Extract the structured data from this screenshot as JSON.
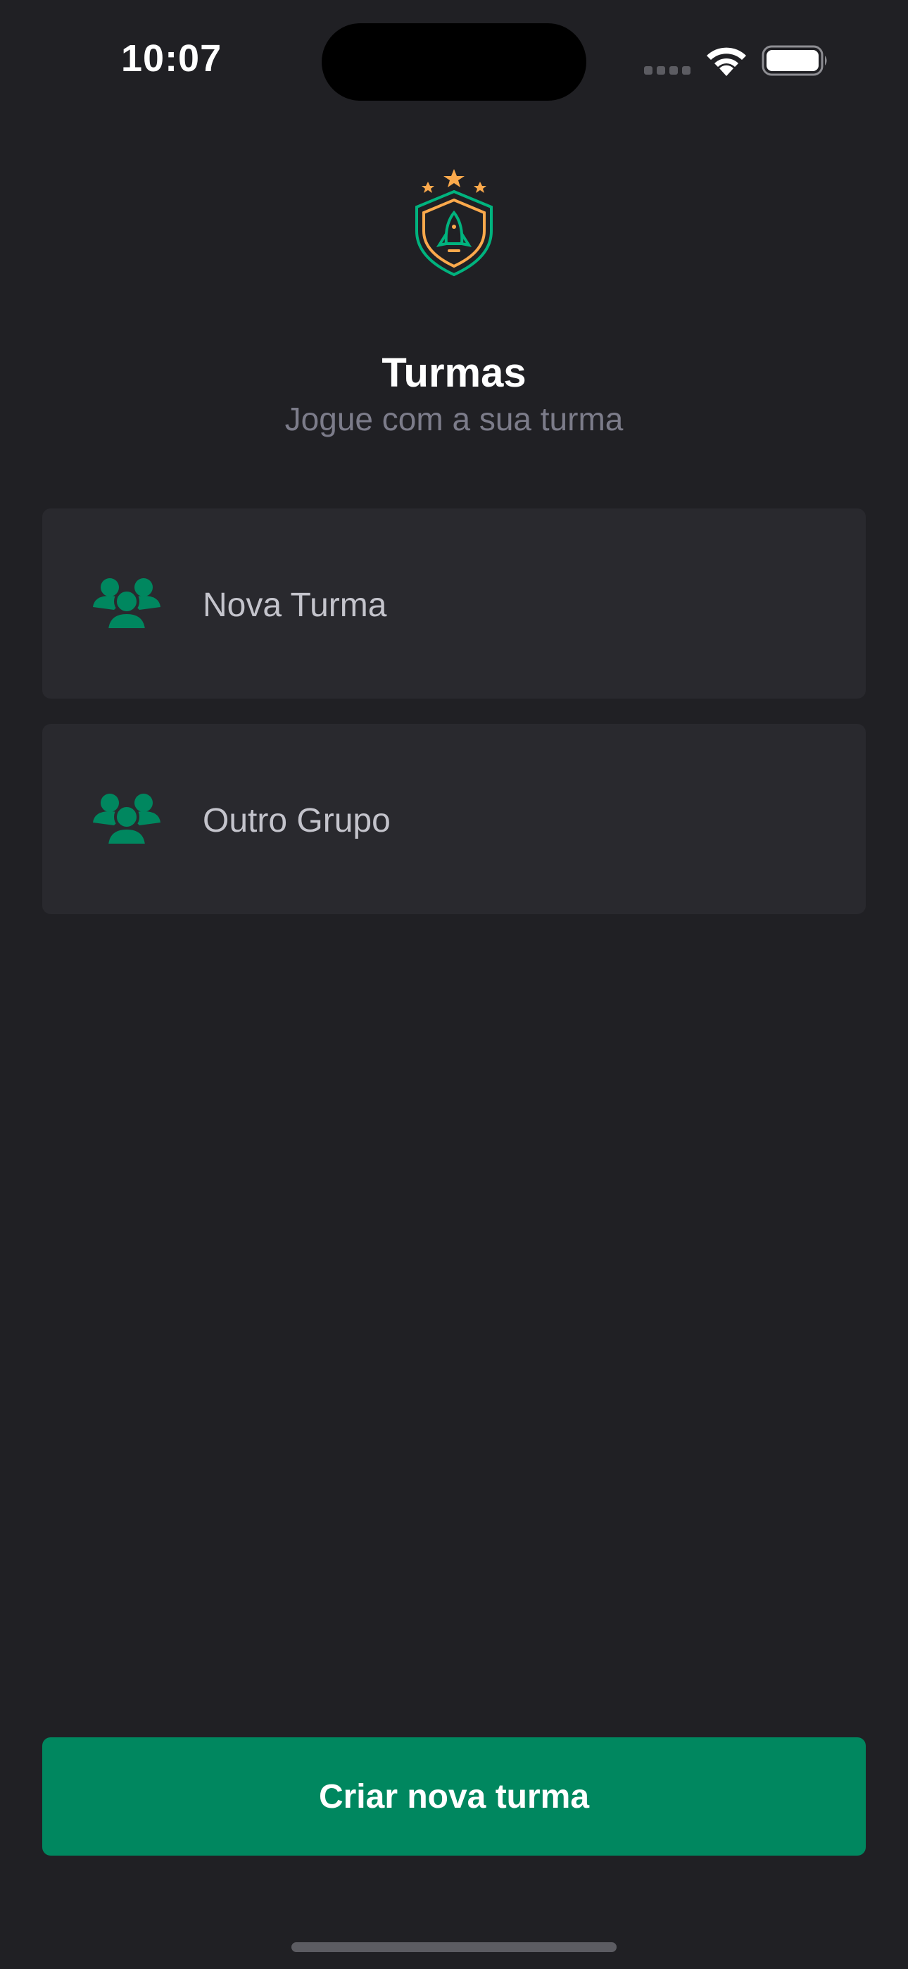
{
  "status_bar": {
    "time": "10:07",
    "icons": [
      "signal-icon",
      "wifi-icon",
      "battery-icon"
    ]
  },
  "header": {
    "logo": "shield-rocket-logo",
    "title": "Turmas",
    "subtitle": "Jogue com a sua turma"
  },
  "groups": [
    {
      "name": "Nova Turma",
      "icon": "group-icon"
    },
    {
      "name": "Outro Grupo",
      "icon": "group-icon"
    }
  ],
  "actions": {
    "create_label": "Criar nova turma"
  },
  "colors": {
    "background": "#202024",
    "card": "#29292e",
    "accent_green": "#00875f",
    "logo_green": "#00b37e",
    "logo_orange": "#fba94c",
    "subtitle": "#7c7c8a",
    "item_text": "#c4c4cc"
  }
}
